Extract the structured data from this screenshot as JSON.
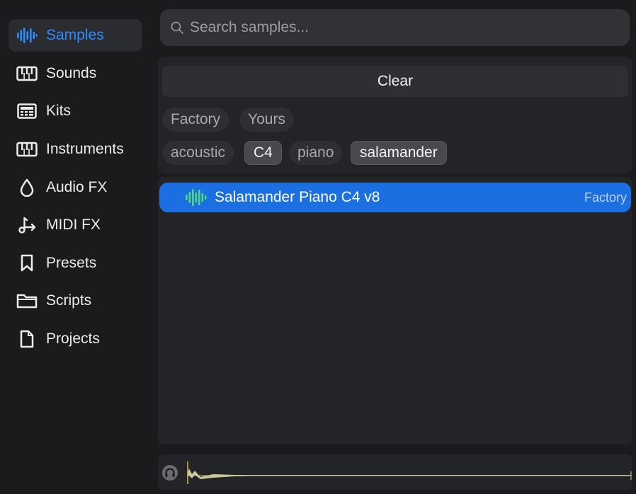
{
  "sidebar": {
    "items": [
      {
        "label": "Samples",
        "icon": "waveform-icon",
        "active": true
      },
      {
        "label": "Sounds",
        "icon": "piano-keys-icon"
      },
      {
        "label": "Kits",
        "icon": "drum-machine-icon"
      },
      {
        "label": "Instruments",
        "icon": "piano-keys-icon"
      },
      {
        "label": "Audio FX",
        "icon": "droplet-icon"
      },
      {
        "label": "MIDI FX",
        "icon": "note-arrow-icon"
      },
      {
        "label": "Presets",
        "icon": "bookmark-icon"
      },
      {
        "label": "Scripts",
        "icon": "folder-icon"
      },
      {
        "label": "Projects",
        "icon": "document-icon"
      }
    ]
  },
  "search": {
    "placeholder": "Search samples...",
    "value": ""
  },
  "filters": {
    "clear_label": "Clear",
    "source_chips": [
      "Factory",
      "Yours"
    ],
    "tag_chips": [
      {
        "label": "acoustic",
        "selected": false
      },
      {
        "label": "C4",
        "selected": true
      },
      {
        "label": "piano",
        "selected": false
      },
      {
        "label": "salamander",
        "selected": true
      }
    ]
  },
  "results": [
    {
      "name": "Salamander Piano C4 v8",
      "source": "Factory",
      "selected": true
    }
  ],
  "colors": {
    "accent": "#2f8cff",
    "selection": "#1b6fe0",
    "waveform_green": "#4fd97c",
    "waveform_preview": "#c8c89a"
  }
}
